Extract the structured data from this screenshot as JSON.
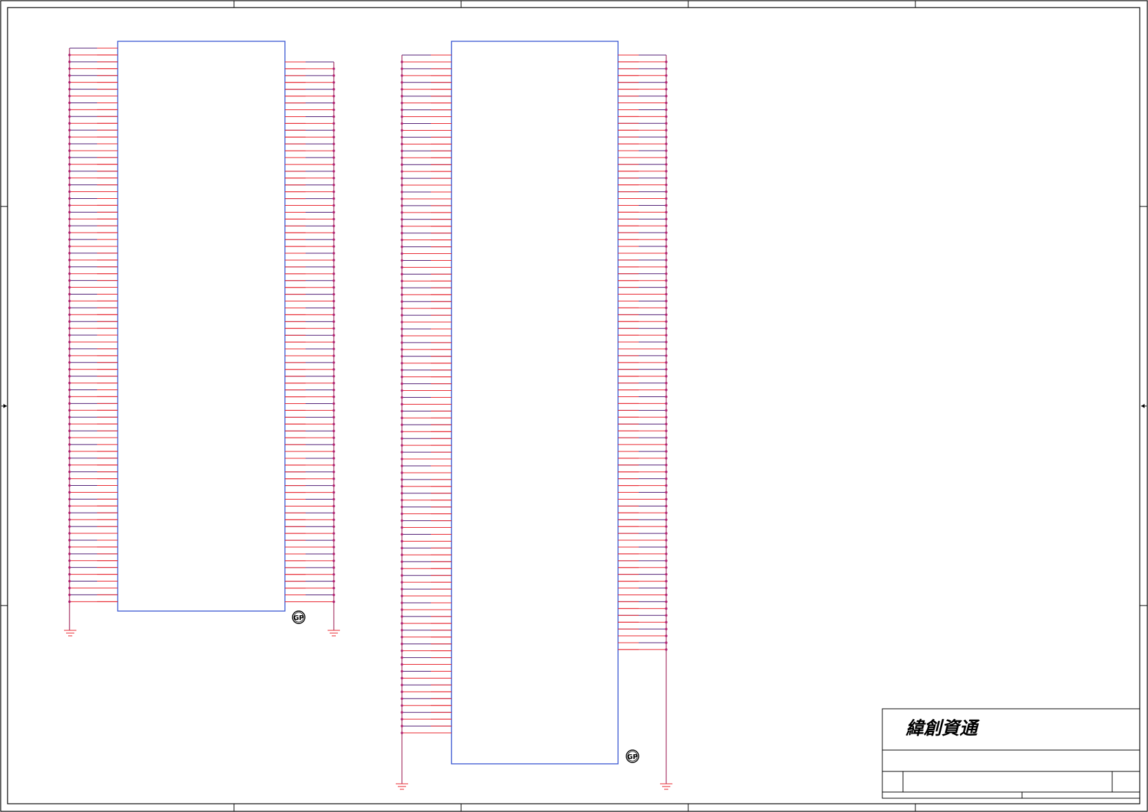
{
  "sheet": {
    "border_color": "#000000",
    "chip_color": "#2f4fd0",
    "pin_color": "#e8202a",
    "net_color": "#4b1670",
    "junction_color": "#c42a8a"
  },
  "components": [
    {
      "id": "connector-left",
      "badge": "GP",
      "left_pin_count": 82,
      "right_pin_count": 80
    },
    {
      "id": "connector-right",
      "badge": "GP",
      "left_pin_count": 100,
      "right_pin_count": 88
    }
  ],
  "title_block": {
    "company": "緯創資通"
  },
  "icons": {
    "ground": "ground-symbol-icon",
    "badge": "gp-circle-icon",
    "border_arrow": "arrow-marker-icon"
  }
}
